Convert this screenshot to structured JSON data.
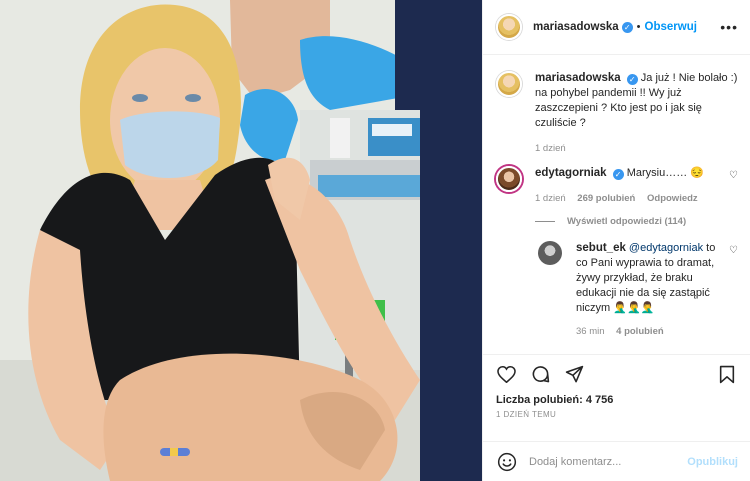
{
  "post": {
    "author": "mariasadowska",
    "separator": "•",
    "follow_label": "Obserwuj",
    "more_label": "•••"
  },
  "caption": {
    "author": "mariasadowska",
    "text": "Ja już ! Nie bolało :) na pohybel pandemii !! Wy już zaszczepieni ? Kto jest po i jak się czuliście ?",
    "age": "1 dzień"
  },
  "comments": [
    {
      "author": "edytagorniak",
      "text": "Marysiu……",
      "emoji": "😔",
      "age": "1 dzień",
      "likes": "269 polubień",
      "reply_label": "Odpowiedz",
      "replies_toggle": "Wyświetl odpowiedzi (114)"
    }
  ],
  "reply": {
    "author": "sebut_ek",
    "mention": "@edytagorniak",
    "text": "to co Pani wyprawia to dramat, żywy przykład, że braku edukacji nie da się zastąpić niczym",
    "emoji": "🤦‍♂️🤦‍♂️🤦‍♂️",
    "age": "36 min",
    "likes": "4 polubień"
  },
  "footer": {
    "likes": "Liczba polubień: 4 756",
    "time": "1 DZIEŃ TEMU",
    "comment_placeholder": "Dodaj komentarz...",
    "publish_label": "Opublikuj"
  },
  "icons": {
    "verified": "verified-badge-icon",
    "heart": "heart-icon",
    "comment": "comment-icon",
    "share": "share-icon",
    "save": "bookmark-icon",
    "emoji": "smiley-icon"
  },
  "colors": {
    "link_blue": "#0095f6",
    "verified_blue": "#3897f0",
    "muted": "#8e8e8e"
  }
}
